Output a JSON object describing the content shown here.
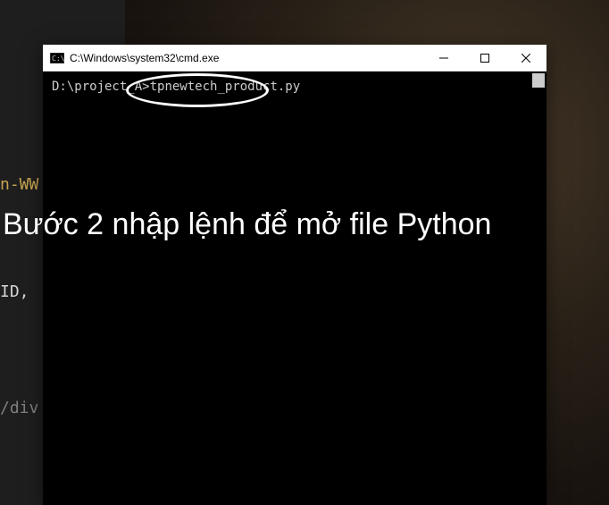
{
  "editor_fragments": {
    "frag1": "n-WW",
    "frag2": "ID,",
    "frag3": "/div"
  },
  "cmd": {
    "title": "C:\\Windows\\system32\\cmd.exe",
    "prompt_path": "D:\\project_A",
    "prompt_separator": ">",
    "command": "tpnewtech_product.py"
  },
  "annotation": {
    "caption": "Bước 2 nhập lệnh để mở file Python"
  }
}
